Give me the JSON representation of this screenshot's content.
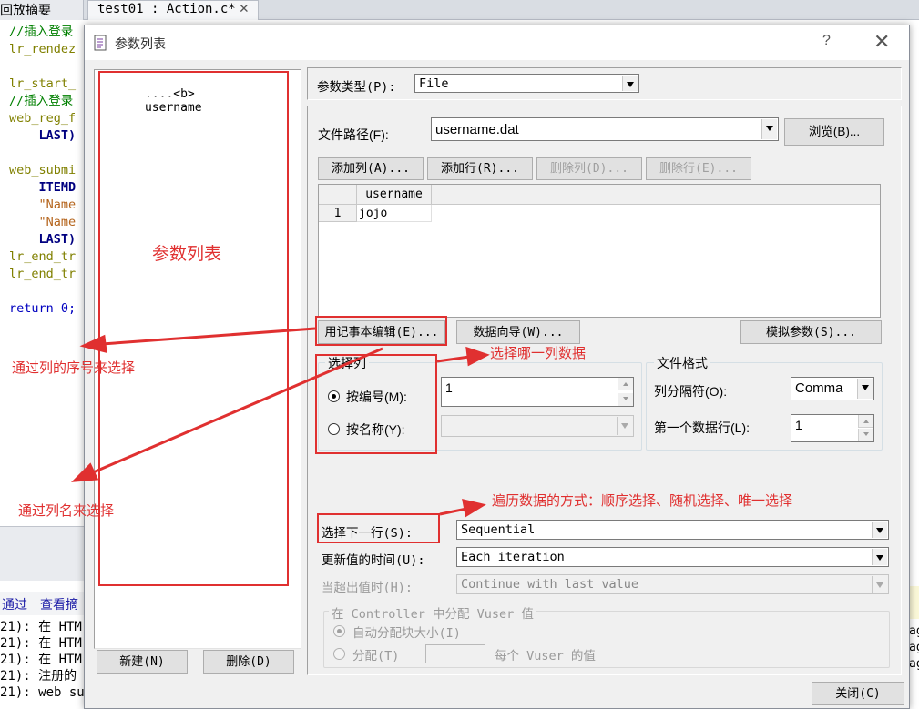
{
  "ide": {
    "tab_replay": "回放摘要",
    "tab_script": "test01 : Action.c*",
    "code_lines": [
      {
        "text": "//插入登录",
        "cls": "c-green"
      },
      {
        "text": "lr_rendez",
        "cls": "c-olive"
      },
      {
        "text": "",
        "cls": ""
      },
      {
        "text": "lr_start_",
        "cls": "c-olive"
      },
      {
        "text": "//插入登录",
        "cls": "c-green"
      },
      {
        "text": "web_reg_f",
        "cls": "c-olive"
      },
      {
        "text": "    LAST)",
        "cls": "c-navy"
      },
      {
        "text": "",
        "cls": ""
      },
      {
        "text": "web_submi",
        "cls": "c-olive"
      },
      {
        "text": "    ITEMD",
        "cls": "c-navy"
      },
      {
        "text": "    \"Name",
        "cls": "c-maroon"
      },
      {
        "text": "    \"Name",
        "cls": "c-maroon"
      },
      {
        "text": "    LAST)",
        "cls": "c-navy"
      },
      {
        "text": "lr_end_tr",
        "cls": "c-olive"
      },
      {
        "text": "lr_end_tr",
        "cls": "c-olive"
      },
      {
        "text": "",
        "cls": ""
      },
      {
        "text": "return 0;",
        "cls": "c-blue"
      }
    ],
    "output_tab_pass": "通过",
    "output_tab_view": "查看摘",
    "output_lines": [
      "21): 在 HTM",
      "21): 在 HTM",
      "21): 在 HTM",
      "21): 注册的",
      "21): web su"
    ],
    "right_strip": [
      "ag",
      "ag",
      "ag"
    ]
  },
  "dialog": {
    "title": "参数列表",
    "help_glyph": "?",
    "close_glyph": "✕",
    "tree_item": "username",
    "param_type_label": "参数类型(P):",
    "param_type_value": "File",
    "file_path_label": "文件路径(F):",
    "file_path_value": "username.dat",
    "browse_button": "浏览(B)...",
    "add_column_button": "添加列(A)...",
    "add_row_button": "添加行(R)...",
    "delete_column_button": "删除列(D)...",
    "delete_row_button": "删除行(E)...",
    "grid": {
      "columns": [
        "username"
      ],
      "rows": [
        {
          "num": "1",
          "values": [
            "jojo"
          ]
        }
      ]
    },
    "notepad_edit_button": "用记事本编辑(E)...",
    "data_wizard_button": "数据向导(W)...",
    "simulate_button": "模拟参数(S)...",
    "select_column_group": "选择列",
    "by_number_label": "按编号(M):",
    "by_number_value": "1",
    "by_name_label": "按名称(Y):",
    "file_format_group": "文件格式",
    "column_delimiter_label": "列分隔符(O):",
    "column_delimiter_value": "Comma",
    "first_data_line_label": "第一个数据行(L):",
    "first_data_line_value": "1",
    "select_next_row_label": "选择下一行(S):",
    "select_next_row_value": "Sequential",
    "update_value_label": "更新值的时间(U):",
    "update_value_value": "Each iteration",
    "out_of_values_label": "当超出值时(H):",
    "out_of_values_value": "Continue with last value",
    "controller_group": "在 Controller 中分配 Vuser 值",
    "auto_allocate_label": "自动分配块大小(I)",
    "allocate_label": "分配(T)",
    "per_vuser_label": "每个 Vuser 的值",
    "new_button": "新建(N)",
    "delete_button": "删除(D)",
    "close_button": "关闭(C)"
  },
  "annotations": {
    "param_list": "参数列表",
    "by_number": "通过列的序号来选择",
    "by_name": "通过列名来选择",
    "which_column": "选择哪一列数据",
    "traversal": "遍历数据的方式：顺序选择、随机选择、唯一选择",
    "color": "#e03030"
  }
}
